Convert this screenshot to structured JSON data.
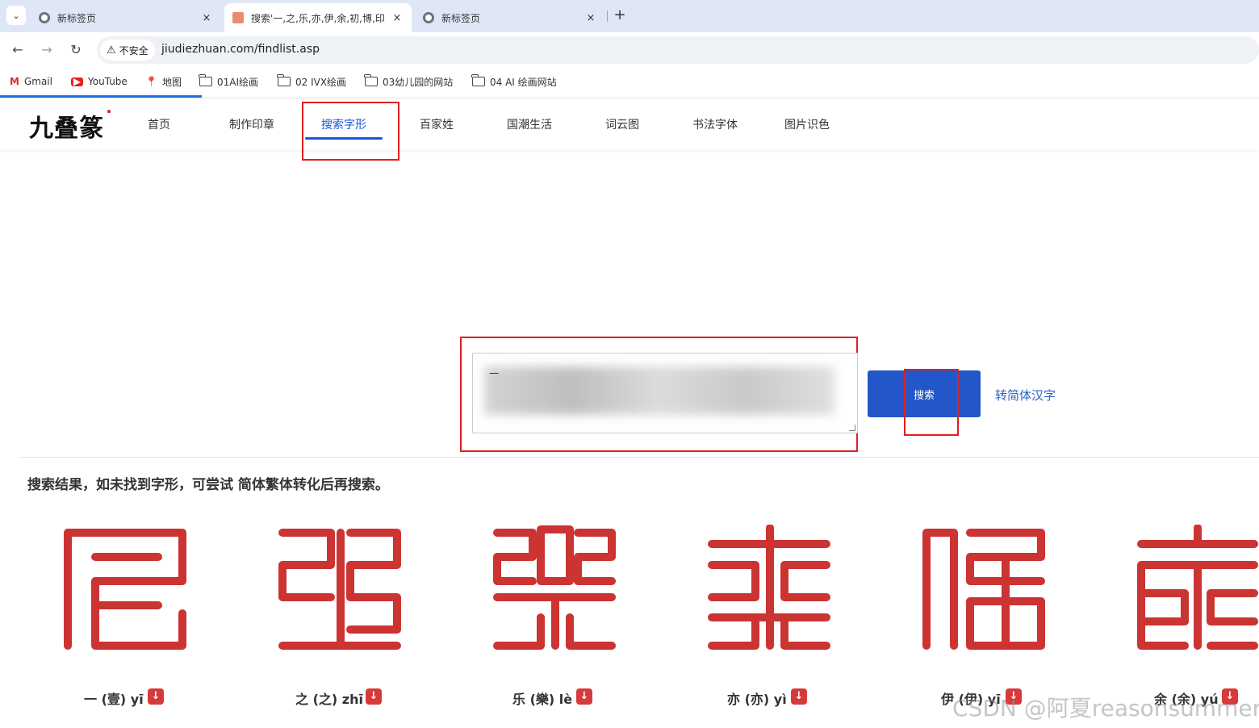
{
  "browser": {
    "tabs": [
      {
        "title": "新标签页",
        "close": "×"
      },
      {
        "title": "搜索'一,之,乐,亦,伊,余,初,博,印,万,",
        "close": "×"
      },
      {
        "title": "新标签页",
        "close": "×"
      }
    ],
    "tab_menu": "⌄",
    "new_tab": "+",
    "security_label": "不安全",
    "url": "jiudiezhuan.com/findlist.asp",
    "bookmarks": [
      {
        "label": "Gmail",
        "icon": "gmail-icon"
      },
      {
        "label": "YouTube",
        "icon": "youtube-icon"
      },
      {
        "label": "地图",
        "icon": "maps-icon"
      },
      {
        "label": "01AI绘画",
        "icon": "folder-icon"
      },
      {
        "label": "02 IVX绘画",
        "icon": "folder-icon"
      },
      {
        "label": "03幼儿园的网站",
        "icon": "folder-icon"
      },
      {
        "label": "04 AI 绘画网站",
        "icon": "folder-icon"
      }
    ]
  },
  "site": {
    "logo": "九叠篆",
    "nav": [
      "首页",
      "制作印章",
      "搜索字形",
      "百家姓",
      "国潮生活",
      "词云图",
      "书法字体",
      "图片识色"
    ],
    "active_nav": "搜索字形"
  },
  "search": {
    "textarea_visible_text": "一",
    "button_label": "搜索",
    "convert_link": "转简体汉字"
  },
  "results": {
    "note": "搜索结果，如未找到字形，可尝试 简体繁体转化后再搜索。",
    "items": [
      {
        "label": "一 (壹) yī"
      },
      {
        "label": "之 (之) zhī"
      },
      {
        "label": "乐 (樂) lè"
      },
      {
        "label": "亦 (亦) yì"
      },
      {
        "label": "伊 (伊) yī"
      },
      {
        "label": "余 (余) yú"
      }
    ],
    "download_icon": "↓"
  },
  "watermark": "CSDN @阿夏reasonsummer",
  "colors": {
    "accent": "#1a56db",
    "button": "#2356c9",
    "seal_red": "#cc3333",
    "annotation_red": "#e02020"
  }
}
